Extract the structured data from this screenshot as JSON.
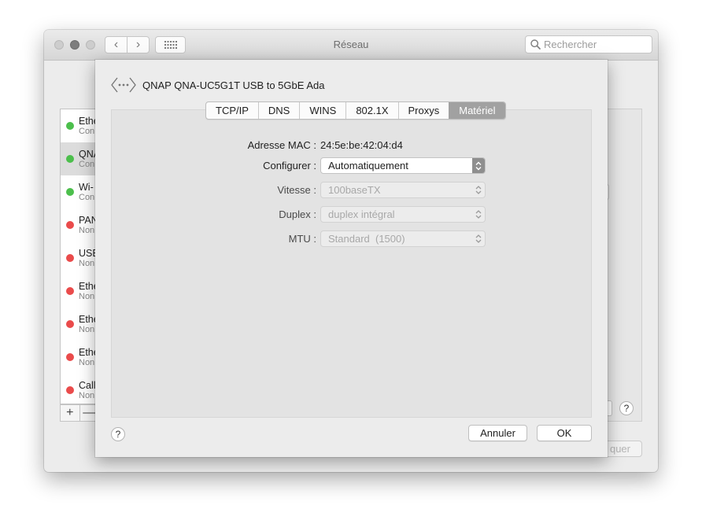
{
  "window": {
    "title": "Réseau",
    "search_placeholder": "Rechercher"
  },
  "sidebar": {
    "items": [
      {
        "name": "Ethe",
        "status": "Con",
        "color": "#4cbf4c",
        "selected": false
      },
      {
        "name": "QNA",
        "status": "Con",
        "color": "#4cbf4c",
        "selected": true
      },
      {
        "name": "Wi-",
        "status": "Con",
        "color": "#4cbf4c",
        "selected": false
      },
      {
        "name": "PAN",
        "status": "Non",
        "color": "#ea4b4b",
        "selected": false
      },
      {
        "name": "USB",
        "status": "Non",
        "color": "#ea4b4b",
        "selected": false
      },
      {
        "name": "Ethe",
        "status": "Non",
        "color": "#ea4b4b",
        "selected": false
      },
      {
        "name": "Ethe",
        "status": "Non",
        "color": "#ea4b4b",
        "selected": false
      },
      {
        "name": "Ethe",
        "status": "Non",
        "color": "#ea4b4b",
        "selected": false
      },
      {
        "name": "Call",
        "status": "Non",
        "color": "#ea4b4b",
        "selected": false
      }
    ],
    "add_label": "+",
    "remove_label": "—"
  },
  "background": {
    "apply_fragment": "quer",
    "help_label": "?"
  },
  "sheet": {
    "title": "QNAP QNA-UC5G1T USB to 5GbE Ada",
    "tabs": [
      {
        "label": "TCP/IP",
        "active": false
      },
      {
        "label": "DNS",
        "active": false
      },
      {
        "label": "WINS",
        "active": false
      },
      {
        "label": "802.1X",
        "active": false
      },
      {
        "label": "Proxys",
        "active": false
      },
      {
        "label": "Matériel",
        "active": true
      }
    ],
    "fields": {
      "mac_label": "Adresse MAC :",
      "mac_value": "24:5e:be:42:04:d4",
      "configure_label": "Configurer :",
      "configure_value": "Automatiquement",
      "speed_label": "Vitesse :",
      "speed_value": "100baseTX",
      "duplex_label": "Duplex :",
      "duplex_value": "duplex intégral",
      "mtu_label": "MTU :",
      "mtu_value": "Standard  (1500)"
    },
    "help_label": "?",
    "cancel_label": "Annuler",
    "ok_label": "OK"
  }
}
